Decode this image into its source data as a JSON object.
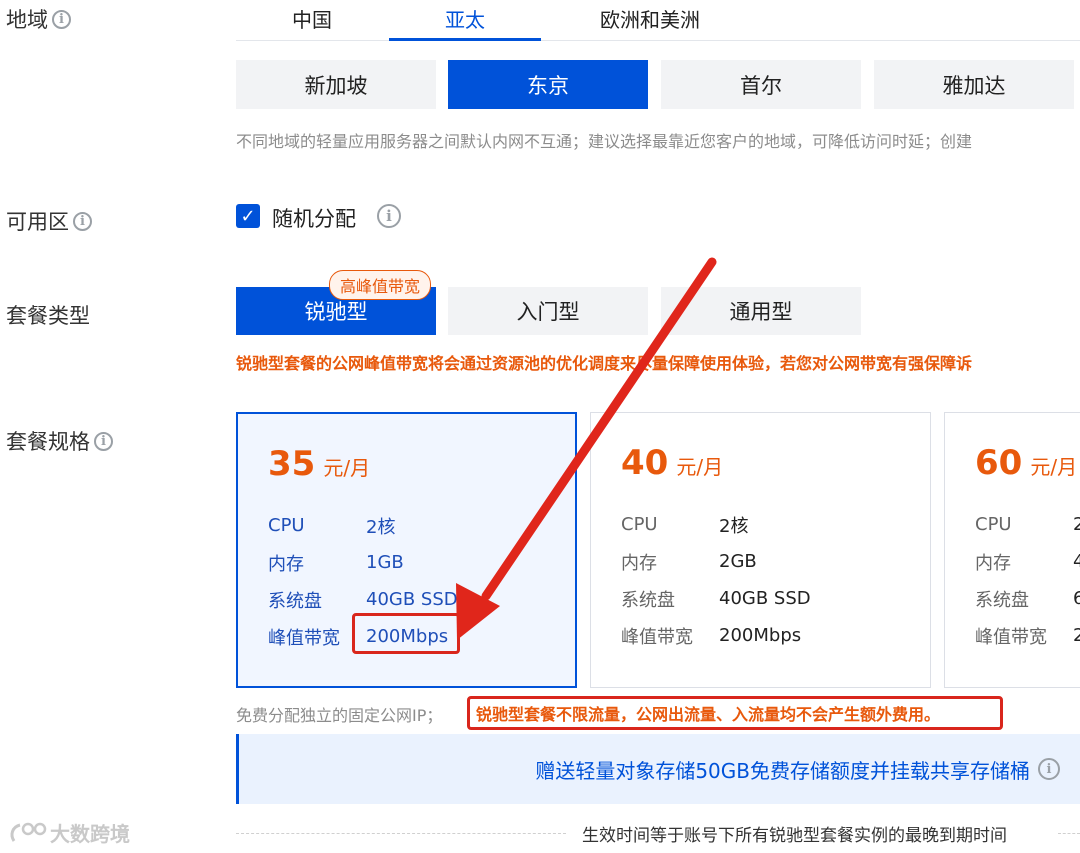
{
  "region": {
    "label": "地域",
    "tabs": [
      {
        "label": "中国"
      },
      {
        "label": "亚太"
      },
      {
        "label": "欧洲和美洲"
      }
    ],
    "active_tab": "亚太",
    "cities": [
      {
        "label": "新加坡"
      },
      {
        "label": "东京"
      },
      {
        "label": "首尔"
      },
      {
        "label": "雅加达"
      }
    ],
    "active_city": "东京",
    "hint": "不同地域的轻量应用服务器之间默认内网不互通；建议选择最靠近您客户的地域，可降低访问时延；创建"
  },
  "zone": {
    "label": "可用区",
    "checkbox_label": "随机分配",
    "checked": true
  },
  "plan_type": {
    "label": "套餐类型",
    "badge": "高峰值带宽",
    "options": [
      {
        "label": "锐驰型"
      },
      {
        "label": "入门型"
      },
      {
        "label": "通用型"
      }
    ],
    "active": "锐驰型",
    "note": "锐驰型套餐的公网峰值带宽将会通过资源池的优化调度来尽量保障使用体验，若您对公网带宽有强保障诉"
  },
  "plan_spec": {
    "label": "套餐规格",
    "cards": [
      {
        "price": "35",
        "unit": "元/月",
        "rows": [
          {
            "key": "CPU",
            "value": "2核"
          },
          {
            "key": "内存",
            "value": "1GB"
          },
          {
            "key": "系统盘",
            "value": "40GB SSD"
          },
          {
            "key": "峰值带宽",
            "value": "200Mbps"
          }
        ]
      },
      {
        "price": "40",
        "unit": "元/月",
        "rows": [
          {
            "key": "CPU",
            "value": "2核"
          },
          {
            "key": "内存",
            "value": "2GB"
          },
          {
            "key": "系统盘",
            "value": "40GB SSD"
          },
          {
            "key": "峰值带宽",
            "value": "200Mbps"
          }
        ]
      },
      {
        "price": "60",
        "unit": "元/月",
        "rows": [
          {
            "key": "CPU",
            "value": "2"
          },
          {
            "key": "内存",
            "value": "4"
          },
          {
            "key": "系统盘",
            "value": "6"
          },
          {
            "key": "峰值带宽",
            "value": "2"
          }
        ]
      }
    ],
    "selected_price": "35"
  },
  "ip_note": {
    "gray": "免费分配独立的固定公网IP；",
    "highlight": "锐驰型套餐不限流量，公网出流量、入流量均不会产生额外费用。"
  },
  "gift_banner": "赠送轻量对象存储50GB免费存储额度并挂载共享存储桶",
  "footer_text": "生效时间等于账号下所有锐驰型套餐实例的最晚到期时间",
  "watermark": "大数跨境",
  "colors": {
    "accent": "#0052d9",
    "orange": "#e8590c",
    "annotation_red": "#d9261c"
  }
}
